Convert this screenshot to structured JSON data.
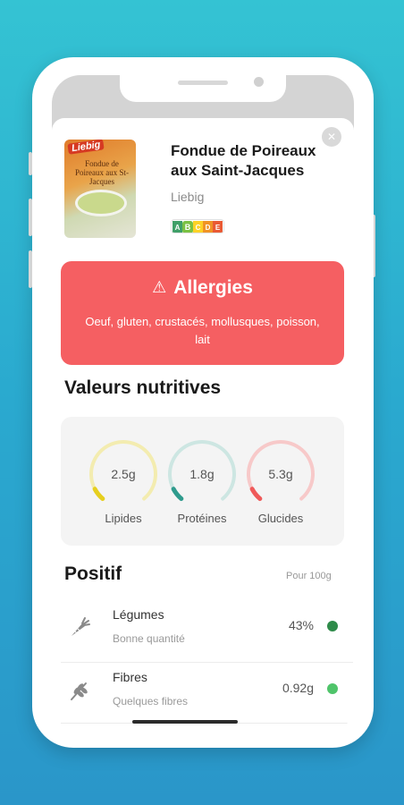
{
  "product": {
    "name": "Fondue de Poireaux aux Saint-Jacques",
    "brand": "Liebig",
    "image_brand_text": "Liebig",
    "image_pack_text": "Fondue de Poireaux aux St-Jacques",
    "nutriscore": {
      "grades": [
        "A",
        "B",
        "C",
        "D",
        "E"
      ],
      "selected": "B"
    }
  },
  "allergies": {
    "title": "Allergies",
    "icon": "warning-icon",
    "text": "Oeuf, gluten, crustacés, mollusques, poisson, lait",
    "color": "#f55f62"
  },
  "nutrition": {
    "title": "Valeurs nutritives",
    "gauges": [
      {
        "label": "Lipides",
        "value": "2.5g",
        "level": 0.08,
        "track_color": "#f3ecb0",
        "fill_color": "#e6cf1f"
      },
      {
        "label": "Protéines",
        "value": "1.8g",
        "level": 0.08,
        "track_color": "#cde6e2",
        "fill_color": "#2f9b8d"
      },
      {
        "label": "Glucides",
        "value": "5.3g",
        "level": 0.08,
        "track_color": "#f7c9c9",
        "fill_color": "#ef5a5a"
      }
    ]
  },
  "positive": {
    "title": "Positif",
    "per": "Pour 100g",
    "items": [
      {
        "title": "Légumes",
        "subtitle": "Bonne quantité",
        "value": "43%",
        "icon": "carrot-icon",
        "dot_color": "#2e8b4a"
      },
      {
        "title": "Fibres",
        "subtitle": "Quelques fibres",
        "value": "0.92g",
        "icon": "wheat-icon",
        "dot_color": "#4fc46a"
      }
    ]
  },
  "nutriscore_colors": [
    "#1e8f4e",
    "#7ac143",
    "#fecb02",
    "#ee8100",
    "#e63e11"
  ]
}
